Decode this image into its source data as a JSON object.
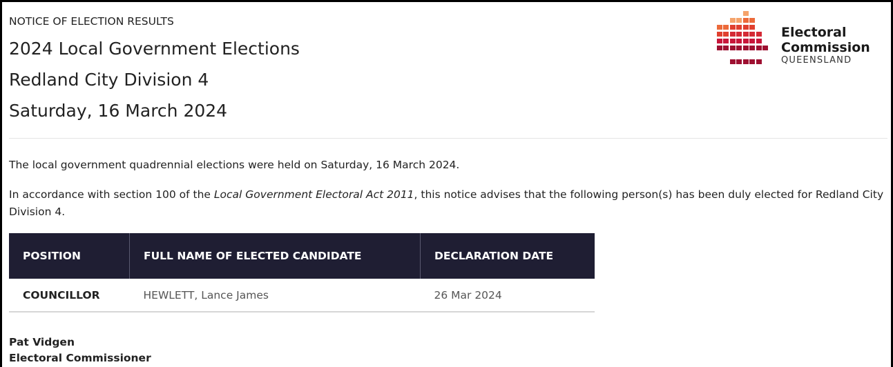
{
  "notice": {
    "kicker": "NOTICE OF ELECTION RESULTS",
    "title_line1": "2024 Local Government Elections",
    "title_line2": "Redland City Division 4",
    "title_line3": "Saturday, 16 March 2024"
  },
  "logo": {
    "line1": "Electoral",
    "line2": "Commission",
    "line3": "QUEENSLAND",
    "colors": [
      "#f5a36b",
      "#ec6a3a",
      "#e0402f",
      "#c8163a",
      "#9e1031"
    ]
  },
  "body": {
    "para1": "The local government quadrennial elections were held on Saturday, 16 March 2024.",
    "para2_prefix": "In accordance with section 100 of the ",
    "para2_act": "Local Government Electoral Act 2011",
    "para2_suffix": ", this notice advises that the following person(s) has been duly elected for Redland City Division 4."
  },
  "table": {
    "headers": [
      "POSITION",
      "FULL NAME OF ELECTED CANDIDATE",
      "DECLARATION DATE"
    ],
    "rows": [
      {
        "position": "COUNCILLOR",
        "name": "HEWLETT, Lance James",
        "date": "26 Mar 2024"
      }
    ]
  },
  "signature": {
    "name": "Pat Vidgen",
    "title": "Electoral Commissioner"
  }
}
